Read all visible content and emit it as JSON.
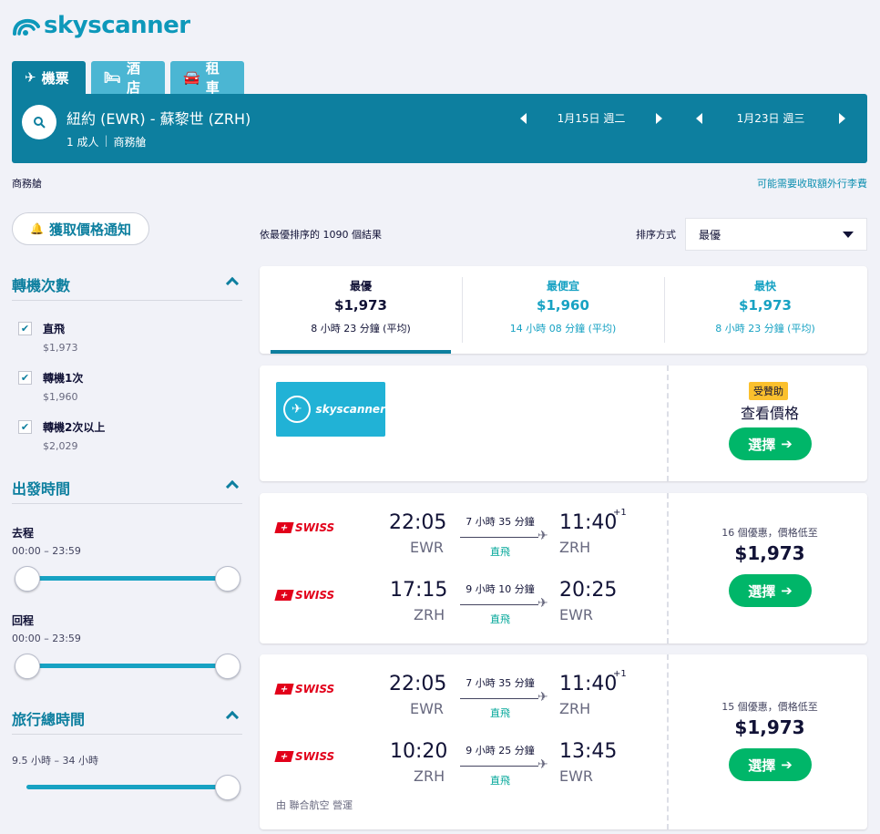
{
  "brand": {
    "logo_text": "skyscanner",
    "icon": "cloud-logo-icon"
  },
  "tabs": [
    {
      "label": "機票",
      "icon": "plane-icon",
      "active": true
    },
    {
      "label": "酒店",
      "icon": "bed-icon",
      "active": false
    },
    {
      "label": "租車",
      "icon": "car-icon",
      "active": false
    }
  ],
  "search": {
    "route": "紐約 (EWR) - 蘇黎世 (ZRH)",
    "passengers": "1 成人",
    "cabin": "商務艙",
    "depart_date": "1月15日 週二",
    "return_date": "1月23日 週三"
  },
  "subbar": {
    "cabin_label": "商務艙",
    "baggage_link": "可能需要收取額外行李費"
  },
  "alert_button": "獲取價格通知",
  "results": {
    "count_text": "依最優排序的 1090 個結果",
    "sort_label": "排序方式",
    "sort_value": "最優"
  },
  "filters": {
    "stops": {
      "title": "轉機次數",
      "options": [
        {
          "label": "直飛",
          "price": "$1,973",
          "checked": true
        },
        {
          "label": "轉機1次",
          "price": "$1,960",
          "checked": true
        },
        {
          "label": "轉機2次以上",
          "price": "$2,029",
          "checked": true
        }
      ]
    },
    "departure_time": {
      "title": "出發時間",
      "outbound_label": "去程",
      "outbound_range": "00:00 – 23:59",
      "return_label": "回程",
      "return_range": "00:00 – 23:59"
    },
    "duration": {
      "title": "旅行總時間",
      "range": "9.5 小時 – 34 小時"
    }
  },
  "sort_tabs": [
    {
      "label": "最優",
      "price": "$1,973",
      "duration": "8 小時 23 分鐘 (平均)",
      "active": true
    },
    {
      "label": "最便宜",
      "price": "$1,960",
      "duration": "14 小時 08 分鐘 (平均)",
      "active": false
    },
    {
      "label": "最快",
      "price": "$1,973",
      "duration": "8 小時 23 分鐘 (平均)",
      "active": false
    }
  ],
  "sponsored": {
    "badge": "受贊助",
    "title": "查看價格",
    "button": "選擇",
    "ad_logo_text": "skyscanner"
  },
  "itineraries": [
    {
      "legs": [
        {
          "airline": "SWISS",
          "dep_time": "22:05",
          "dep_code": "EWR",
          "duration": "7 小時 35 分鐘",
          "stops": "直飛",
          "arr_time": "11:40",
          "arr_code": "ZRH",
          "day_offset": "+1"
        },
        {
          "airline": "SWISS",
          "dep_time": "17:15",
          "dep_code": "ZRH",
          "duration": "9 小時 10 分鐘",
          "stops": "直飛",
          "arr_time": "20:25",
          "arr_code": "EWR",
          "day_offset": ""
        }
      ],
      "deals": "16 個優惠，價格低至",
      "price": "$1,973",
      "button": "選擇",
      "operated_by": ""
    },
    {
      "legs": [
        {
          "airline": "SWISS",
          "dep_time": "22:05",
          "dep_code": "EWR",
          "duration": "7 小時 35 分鐘",
          "stops": "直飛",
          "arr_time": "11:40",
          "arr_code": "ZRH",
          "day_offset": "+1"
        },
        {
          "airline": "SWISS",
          "dep_time": "10:20",
          "dep_code": "ZRH",
          "duration": "9 小時 25 分鐘",
          "stops": "直飛",
          "arr_time": "13:45",
          "arr_code": "EWR",
          "day_offset": ""
        }
      ],
      "deals": "15 個優惠，價格低至",
      "price": "$1,973",
      "button": "選擇",
      "operated_by": "由 聯合航空 營運"
    }
  ],
  "colors": {
    "primary": "#0d7f9f",
    "tab": "#4bb6d3",
    "accent": "#17a2c3",
    "cta": "#00b669",
    "airline_red": "#e2001a"
  }
}
